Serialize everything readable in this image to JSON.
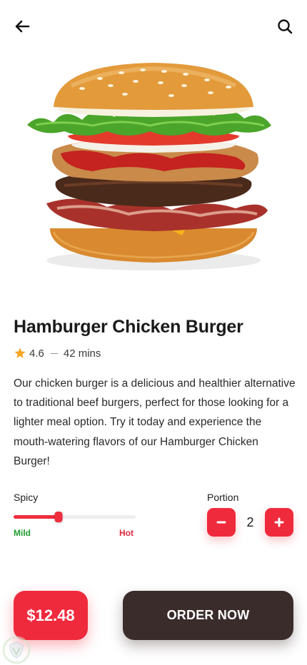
{
  "header": {
    "back_icon": "arrow-left-icon",
    "search_icon": "search-icon"
  },
  "product": {
    "image": "burger-image",
    "name": "Hamburger Chicken Burger",
    "rating": "4.6",
    "time": "42 mins",
    "description": "Our chicken burger is a delicious and healthier alternative to traditional beef burgers, perfect for those looking for a lighter meal option. Try it today and experience the mouth-watering flavors of our Hamburger Chicken Burger!"
  },
  "spicy": {
    "label": "Spicy",
    "min_label": "Mild",
    "max_label": "Hot",
    "level": 0.37
  },
  "portion": {
    "label": "Portion",
    "quantity": "2"
  },
  "footer": {
    "price": "$12.48",
    "order_label": "ORDER NOW"
  },
  "colors": {
    "accent": "#ef2a3c",
    "dark": "#3b2c2c",
    "mild": "#1f9d2e",
    "hot": "#e2263a",
    "star": "#f5a623"
  }
}
